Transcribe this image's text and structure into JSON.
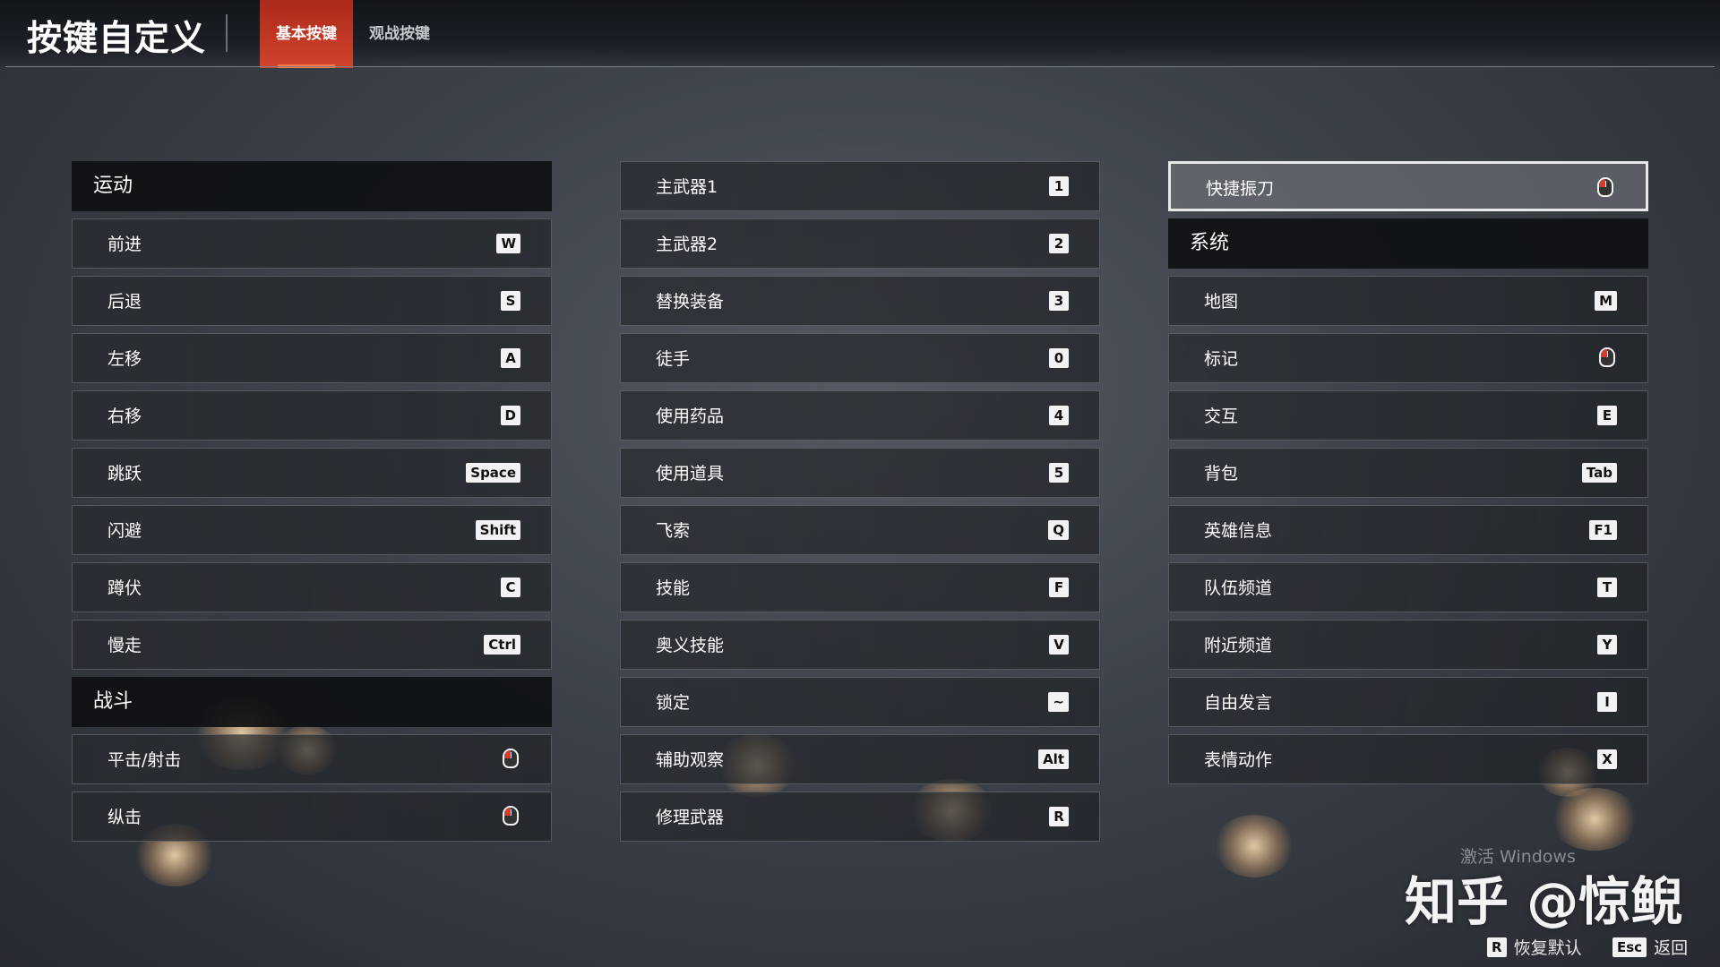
{
  "header": {
    "title": "按键自定义",
    "tabs": [
      {
        "label": "基本按键",
        "active": true
      },
      {
        "label": "观战按键",
        "active": false
      }
    ]
  },
  "colors": {
    "accent": "#d2432b",
    "key_bg": "#f2f2f2",
    "header_bg": "#0e1013"
  },
  "columns": [
    [
      {
        "type": "header",
        "label": "运动"
      },
      {
        "label": "前进",
        "key": "W"
      },
      {
        "label": "后退",
        "key": "S"
      },
      {
        "label": "左移",
        "key": "A"
      },
      {
        "label": "右移",
        "key": "D"
      },
      {
        "label": "跳跃",
        "key": "Space"
      },
      {
        "label": "闪避",
        "key": "Shift"
      },
      {
        "label": "蹲伏",
        "key": "C"
      },
      {
        "label": "慢走",
        "key": "Ctrl"
      },
      {
        "type": "header",
        "label": "战斗"
      },
      {
        "label": "平击/射击",
        "icon": "mouse-left-icon"
      },
      {
        "label": "纵击",
        "icon": "mouse-left-icon"
      }
    ],
    [
      {
        "label": "主武器1",
        "key": "1"
      },
      {
        "label": "主武器2",
        "key": "2"
      },
      {
        "label": "替换装备",
        "key": "3"
      },
      {
        "label": "徒手",
        "key": "0"
      },
      {
        "label": "使用药品",
        "key": "4"
      },
      {
        "label": "使用道具",
        "key": "5"
      },
      {
        "label": "飞索",
        "key": "Q"
      },
      {
        "label": "技能",
        "key": "F"
      },
      {
        "label": "奥义技能",
        "key": "V"
      },
      {
        "label": "锁定",
        "key": "~"
      },
      {
        "label": "辅助观察",
        "key": "Alt"
      },
      {
        "label": "修理武器",
        "key": "R"
      }
    ],
    [
      {
        "label": "快捷振刀",
        "icon": "mouse-left-icon",
        "selected": true
      },
      {
        "type": "header",
        "label": "系统"
      },
      {
        "label": "地图",
        "key": "M"
      },
      {
        "label": "标记",
        "icon": "mouse-left-icon"
      },
      {
        "label": "交互",
        "key": "E"
      },
      {
        "label": "背包",
        "key": "Tab"
      },
      {
        "label": "英雄信息",
        "key": "F1"
      },
      {
        "label": "队伍频道",
        "key": "T"
      },
      {
        "label": "附近频道",
        "key": "Y"
      },
      {
        "label": "自由发言",
        "key": "I"
      },
      {
        "label": "表情动作",
        "key": "X"
      }
    ]
  ],
  "overlay": {
    "watermark": "知乎 @惊鲵",
    "activate_windows": "激活 Windows"
  },
  "footer": {
    "reset_key": "R",
    "reset_label": "恢复默认",
    "back_key": "Esc",
    "back_label": "返回"
  }
}
